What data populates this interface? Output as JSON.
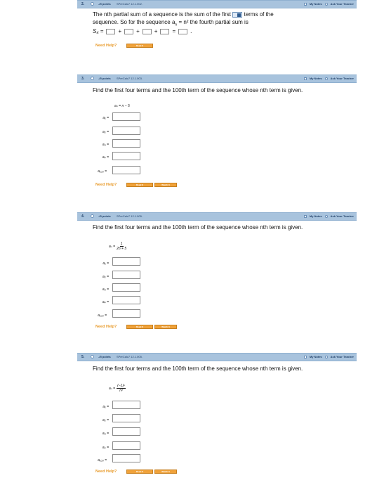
{
  "common": {
    "points": "-/5 points",
    "my_notes": "My Notes",
    "ask_teacher": "Ask Your Teacher",
    "need_help": "Need Help?",
    "read_it": "Read It",
    "watch_it": "Watch It",
    "eq": "=",
    "plus": "+"
  },
  "q2": {
    "number": "2.",
    "source": "SPreCalc7 12.1.002.",
    "prompt_a": "The nth partial sum of a sequence is the sum of the first",
    "prompt_b": "terms of the",
    "prompt_c": "sequence. So for the sequence a",
    "prompt_d": "= n² the fourth partial sum is",
    "s4_label": "S₄ ="
  },
  "q3": {
    "number": "3.",
    "source": "SPreCalc7 12.1.003.",
    "prompt": "Find the first four terms and the 100th term of the sequence whose nth term is given.",
    "formula": "aₙ = n − 5",
    "labels": [
      "a₁ =",
      "a₂ =",
      "a₃ =",
      "a₄ =",
      "a₁₀₀ ="
    ]
  },
  "q4": {
    "number": "4.",
    "source": "SPreCalc7 12.1.005.",
    "prompt": "Find the first four terms and the 100th term of the sequence whose nth term is given.",
    "formula_lhs": "aₙ =",
    "formula_num": "1",
    "formula_den": "2n + 5",
    "labels": [
      "a₁ =",
      "a₂ =",
      "a₃ =",
      "a₄ =",
      "a₁₀₀ ="
    ]
  },
  "q5": {
    "number": "5.",
    "source": "SPreCalc7 12.1.005.",
    "prompt": "Find the first four terms and the 100th term of the sequence whose nth term is given.",
    "formula_lhs": "aₙ =",
    "formula_num": "(−1)ⁿ",
    "formula_den": "n²",
    "labels": [
      "a₁ =",
      "a₂ =",
      "a₃ =",
      "a₄ =",
      "a₁₀₀ ="
    ]
  }
}
